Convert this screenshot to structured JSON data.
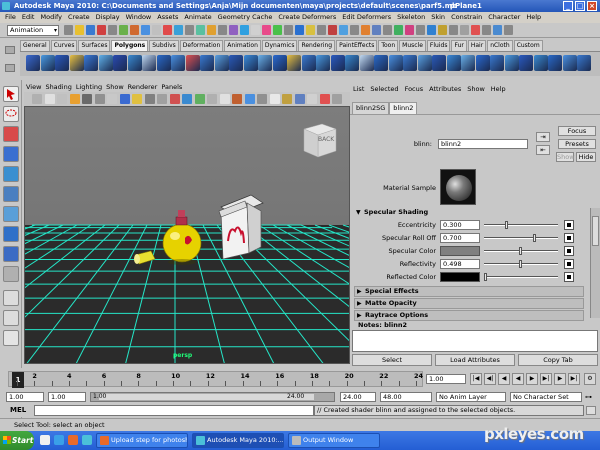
{
  "window": {
    "title": "Autodesk Maya 2010: C:\\Documents and Settings\\Anja\\Mijn documenten\\maya\\projects\\default\\scenes\\parf5.mb",
    "object": "pPlane1"
  },
  "menubar": [
    "File",
    "Edit",
    "Modify",
    "Create",
    "Display",
    "Window",
    "Assets",
    "Animate",
    "Geometry Cache",
    "Create Deformers",
    "Edit Deformers",
    "Skeleton",
    "Skin",
    "Constrain",
    "Character",
    "Help"
  ],
  "statusline": {
    "mode": "Animation"
  },
  "shelf_tabs": [
    "General",
    "Curves",
    "Surfaces",
    "Polygons",
    "Subdivs",
    "Deformation",
    "Animation",
    "Dynamics",
    "Rendering",
    "PaintEffects",
    "Toon",
    "Muscle",
    "Fluids",
    "Fur",
    "Hair",
    "nCloth",
    "Custom"
  ],
  "shelf_active": "Polygons",
  "viewport": {
    "menu": [
      "View",
      "Shading",
      "Lighting",
      "Show",
      "Renderer",
      "Panels"
    ],
    "camera_label": "persp",
    "view_cube_label": "BACK"
  },
  "attribute_editor": {
    "menu": [
      "List",
      "Selected",
      "Focus",
      "Attributes",
      "Show",
      "Help"
    ],
    "tabs": [
      "blinn2SG",
      "blinn2"
    ],
    "active_tab": "blinn2",
    "node_type_label": "blinn:",
    "node_name": "blinn2",
    "buttons": {
      "focus": "Focus",
      "presets": "Presets",
      "show": "Show",
      "hide": "Hide"
    },
    "material_sample_label": "Material Sample",
    "specular_section": "Specular Shading",
    "attributes": [
      {
        "label": "Eccentricity",
        "value": "0.300",
        "fraction": 0.3
      },
      {
        "label": "Specular Roll Off",
        "value": "0.700",
        "fraction": 0.7
      },
      {
        "label": "Specular Color",
        "swatch": "#808080",
        "fraction": 0.5
      },
      {
        "label": "Reflectivity",
        "value": "0.498",
        "fraction": 0.5
      },
      {
        "label": "Reflected Color",
        "swatch": "#000000",
        "fraction": 0.0
      }
    ],
    "sections": [
      "Special Effects",
      "Matte Opacity",
      "Raytrace Options"
    ],
    "notes_label": "Notes:  blinn2",
    "bottom_buttons": [
      "Select",
      "Load Attributes",
      "Copy Tab"
    ]
  },
  "timeline": {
    "ticks": [
      "2",
      "4",
      "6",
      "8",
      "10",
      "12",
      "14",
      "16",
      "18",
      "20",
      "22",
      "24"
    ],
    "current_frame": "1",
    "current_time": "1.00"
  },
  "range": {
    "start": "1.00",
    "playback_start": "1.00",
    "range_label_a": "1.00",
    "range_label_b": "24.00",
    "playback_end": "24.00",
    "end": "48.00",
    "anim_layer": "No Anim Layer",
    "character_set": "No Character Set"
  },
  "command": {
    "label": "MEL",
    "output": "// Created shader blinn and assigned to the selected objects."
  },
  "helpline": "Select Tool: select an object",
  "taskbar": {
    "start": "Start",
    "tasks": [
      "Upload step for photosh...",
      "Autodesk Maya 2010:...",
      "Output Window"
    ],
    "active_task": 1
  },
  "watermark": "pxleyes.com",
  "colors": {
    "viewport_bg": "#767676",
    "grid": "#25e6c8",
    "titlebar": "#2a5cc0",
    "ui_bg": "#c8c8c8"
  }
}
